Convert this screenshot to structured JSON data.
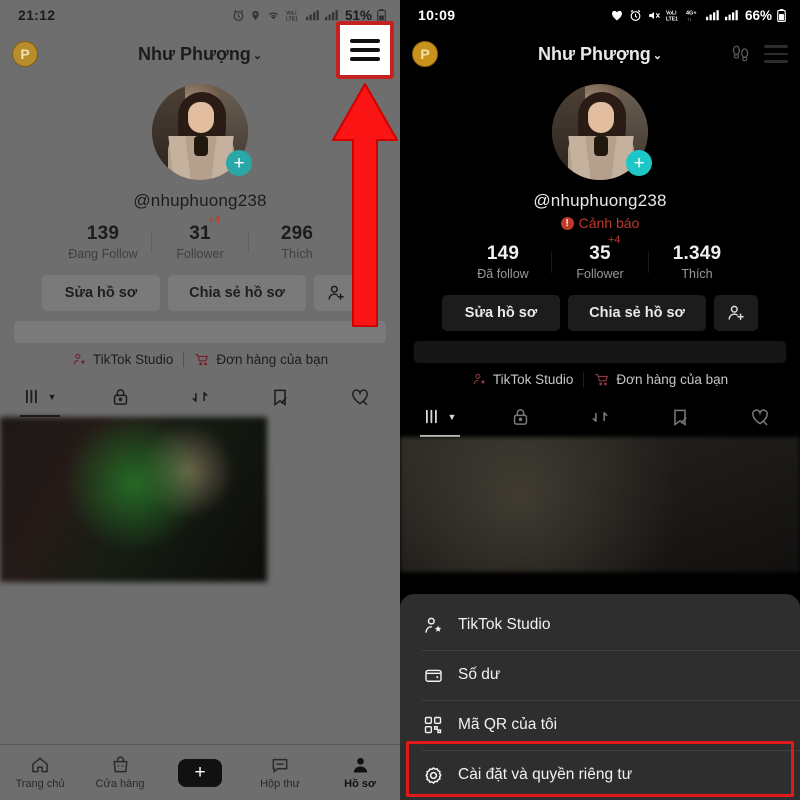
{
  "meta": {
    "accent_red": "#e01a1a",
    "brand_teal": "#1ec7c7",
    "warn_red": "#c0392b"
  },
  "left_panel": {
    "status_bar": {
      "time": "21:12",
      "battery": "51%",
      "icons": [
        "alarm-icon",
        "location-icon",
        "wifi-icon",
        "volte-lte-icon",
        "signal-bars-icon",
        "signal-bars-2-icon",
        "battery-icon"
      ]
    },
    "header": {
      "coin_label": "P",
      "title": "Như Phượng",
      "chevron": "⌄",
      "avatar_count": "1",
      "menu_icon": "hamburger-menu-icon"
    },
    "profile": {
      "handle": "@nhuphuong238",
      "add_badge": "+"
    },
    "stats": [
      {
        "num": "139",
        "label": "Đang Follow",
        "delta": ""
      },
      {
        "num": "31",
        "label": "Follower",
        "delta": "+4"
      },
      {
        "num": "296",
        "label": "Thích",
        "delta": ""
      }
    ],
    "actions": {
      "edit_profile": "Sửa hồ sơ",
      "share_profile": "Chia sẻ hồ sơ",
      "add_friend_icon": "add-person-icon"
    },
    "quick_links": [
      {
        "label": "TikTok Studio",
        "icon": "person-star-icon"
      },
      {
        "label": "Đơn hàng của bạn",
        "icon": "cart-icon"
      }
    ],
    "tabs": [
      {
        "name": "videos",
        "icon": "grid-posts-icon",
        "active": true
      },
      {
        "name": "private",
        "icon": "lock-icon",
        "active": false
      },
      {
        "name": "reposts",
        "icon": "repost-icon",
        "active": false
      },
      {
        "name": "saved",
        "icon": "bookmark-hidden-icon",
        "active": false
      },
      {
        "name": "liked",
        "icon": "heart-hidden-icon",
        "active": false
      }
    ],
    "bottom_nav": [
      {
        "label": "Trang chủ",
        "icon": "home-icon",
        "active": false
      },
      {
        "label": "Cửa hàng",
        "icon": "shop-bag-icon",
        "active": false
      },
      {
        "label": "",
        "icon": "create-plus-icon",
        "active": false
      },
      {
        "label": "Hộp thư",
        "icon": "inbox-icon",
        "active": false
      },
      {
        "label": "Hồ sơ",
        "icon": "profile-person-icon",
        "active": true
      }
    ]
  },
  "right_panel": {
    "status_bar": {
      "time": "10:09",
      "battery": "66%",
      "icons": [
        "heart-icon",
        "alarm-icon",
        "mute-icon",
        "volte-lte-icon",
        "4g-plus-icon",
        "signal-bars-icon",
        "signal-bars-2-icon",
        "battery-icon"
      ]
    },
    "header": {
      "coin_label": "P",
      "title": "Như Phượng",
      "chevron": "⌄",
      "footprints_icon": "footprints-icon",
      "menu_icon": "hamburger-menu-icon"
    },
    "profile": {
      "handle": "@nhuphuong238",
      "warning": "Cảnh báo",
      "warning_badge": "!",
      "add_badge": "+"
    },
    "stats": [
      {
        "num": "149",
        "label": "Đã follow",
        "delta": ""
      },
      {
        "num": "35",
        "label": "Follower",
        "delta": "+4"
      },
      {
        "num": "1.349",
        "label": "Thích",
        "delta": ""
      }
    ],
    "actions": {
      "edit_profile": "Sửa hồ sơ",
      "share_profile": "Chia sẻ hồ sơ",
      "add_friend_icon": "add-person-icon"
    },
    "quick_links": [
      {
        "label": "TikTok Studio",
        "icon": "person-star-icon"
      },
      {
        "label": "Đơn hàng của bạn",
        "icon": "cart-icon"
      }
    ],
    "tabs": [
      {
        "name": "videos",
        "icon": "grid-posts-icon",
        "active": true
      },
      {
        "name": "private",
        "icon": "lock-icon",
        "active": false
      },
      {
        "name": "reposts",
        "icon": "repost-icon",
        "active": false
      },
      {
        "name": "saved",
        "icon": "bookmark-hidden-icon",
        "active": false
      },
      {
        "name": "liked",
        "icon": "heart-hidden-icon",
        "active": false
      }
    ],
    "sheet_items": [
      {
        "label": "TikTok Studio",
        "icon": "person-star-icon",
        "highlighted": false
      },
      {
        "label": "Số dư",
        "icon": "wallet-icon",
        "highlighted": false
      },
      {
        "label": "Mã QR của tôi",
        "icon": "qr-code-icon",
        "highlighted": false
      },
      {
        "label": "Cài đặt và quyền riêng tư",
        "icon": "gear-icon",
        "highlighted": true
      }
    ]
  },
  "annotations": {
    "arrow": "red-up-arrow",
    "menu_highlight_box": "red-square-highlight",
    "settings_highlight_box": "red-rect-highlight"
  }
}
